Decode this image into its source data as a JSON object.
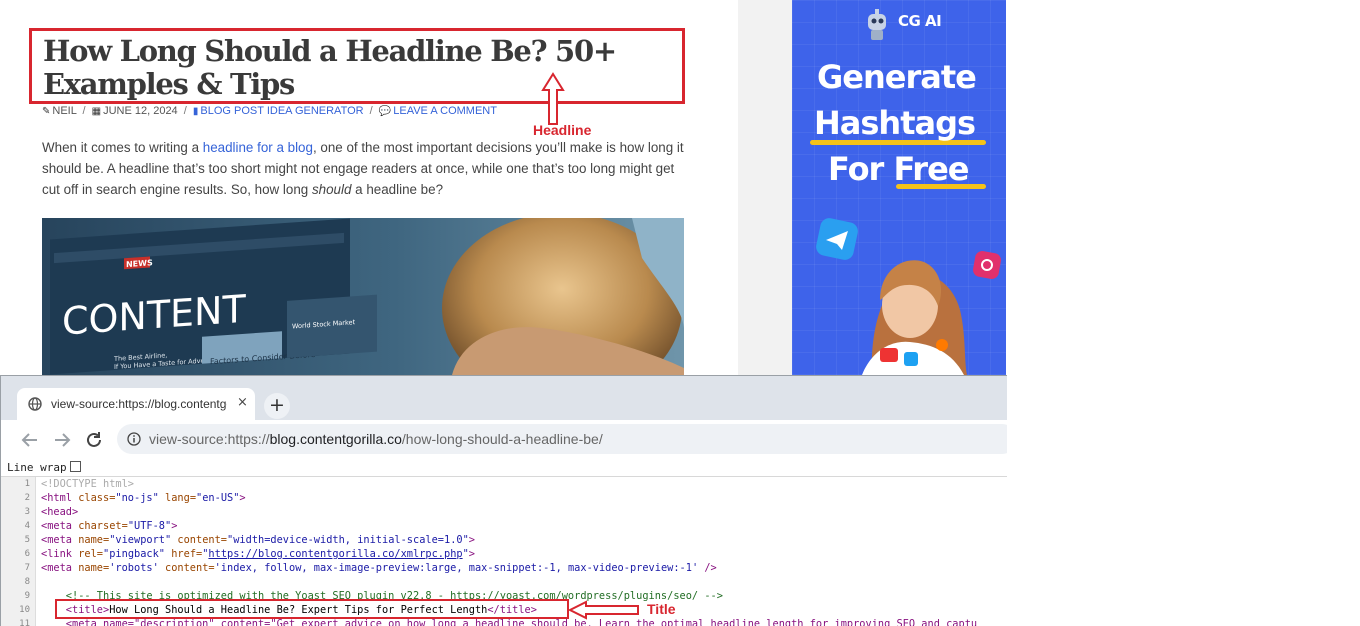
{
  "blog": {
    "headline": "How Long Should a Headline Be? 50+ Examples & Tips",
    "annotation_headline": "Headline",
    "meta": {
      "author": "NEIL",
      "date": "JUNE 12, 2024",
      "category": "BLOG POST IDEA GENERATOR",
      "comment": "LEAVE A COMMENT",
      "separator": "/"
    },
    "intro": {
      "part1": "When it comes to writing a ",
      "link": "headline for a blog",
      "part2": ", one of the most important decisions you’ll make is how long it should be. A headline that’s too short might not engage readers at once, while one that’s too long might get cut off in search engine results. So, how long ",
      "emphasis": "should",
      "part3": " a headline be?"
    },
    "hero_image": {
      "nav_items": [
        "NEWS"
      ],
      "headline": "CONTENT",
      "sub1": "The Best Airline,",
      "sub2": "If You Have a Taste for Adventure",
      "sub3": "World Stock Market",
      "sub4": "Factors to Consider Before"
    }
  },
  "ad": {
    "logo_text": "CG AI",
    "line1": "Generate",
    "line2": "Hashtags",
    "line3": "For Free",
    "colors": {
      "background": "#3e63ea",
      "accent": "#f5c21a"
    }
  },
  "browser": {
    "tab_title": "view-source:https://blog.contentgorilla.co/how-long-should-a-headline-be/",
    "tab_close": "×",
    "new_tab": "+",
    "url_prefix": "view-source:https://",
    "url_domain": "blog.contentgorilla.co",
    "url_path": "/how-long-should-a-headline-be/",
    "line_wrap_label": "Line wrap",
    "line_wrap_checked": false
  },
  "source": {
    "line_numbers": [
      "1",
      "2",
      "3",
      "4",
      "5",
      "6",
      "7",
      "8",
      "9",
      "10",
      "11"
    ],
    "l1": "<!DOCTYPE html>",
    "l2_a": "<html ",
    "l2_b": "class=",
    "l2_c": "\"no-js\" ",
    "l2_d": "lang=",
    "l2_e": "\"en-US\"",
    "l2_f": ">",
    "l3": "<head>",
    "l4_a": "<meta ",
    "l4_b": "charset=",
    "l4_c": "\"UTF-8\"",
    "l4_d": ">",
    "l5_a": "<meta ",
    "l5_b": "name=",
    "l5_c": "\"viewport\" ",
    "l5_d": "content=",
    "l5_e": "\"width=device-width, initial-scale=1.0\"",
    "l5_f": ">",
    "l6_a": "<link ",
    "l6_b": "rel=",
    "l6_c": "\"pingback\" ",
    "l6_d": "href=",
    "l6_e": "\"",
    "l6_link": "https://blog.contentgorilla.co/xmlrpc.php",
    "l6_f": "\"",
    "l6_g": ">",
    "l7_a": "<meta ",
    "l7_b": "name=",
    "l7_c": "'robots' ",
    "l7_d": "content=",
    "l7_e": "'index, follow, max-image-preview:large, max-snippet:-1, max-video-preview:-1' ",
    "l7_f": "/>",
    "l9": "    <!-- This site is optimized with the Yoast SEO plugin v22.8 - https://yoast.com/wordpress/plugins/seo/ -->",
    "l10_open": "    <title>",
    "l10_text": "How Long Should a Headline Be? Expert Tips for Perfect Length",
    "l10_close": "</title>",
    "l11": "    <meta name=\"description\" content=\"Get expert advice on how long a headline should be. Learn the optimal headline length for improving SEO and captu",
    "annotation_title": "Title"
  }
}
